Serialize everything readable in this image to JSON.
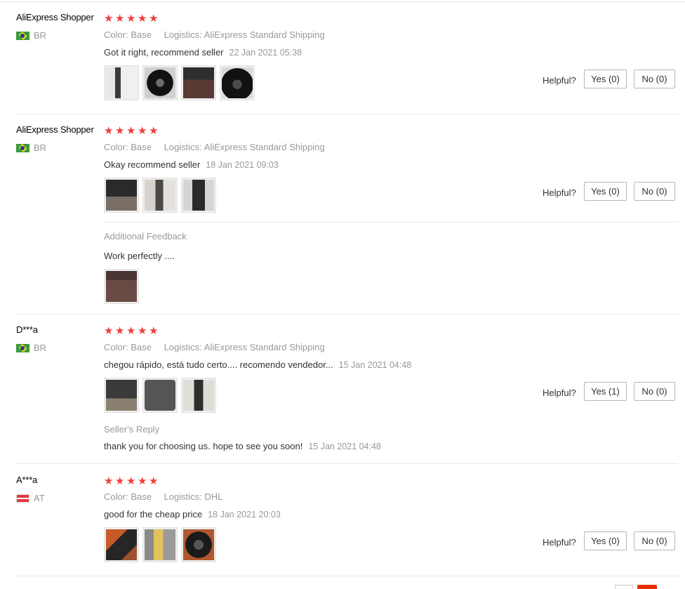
{
  "reviews": [
    {
      "user": "AliExpress Shopper",
      "country": "BR",
      "flag": "brazil-flag",
      "stars": 5,
      "color_label": "Color:",
      "color_value": "Base",
      "logistics_label": "Logistics:",
      "logistics_value": "AliExpress Standard Shipping",
      "text": "Got it right, recommend seller",
      "date": "22 Jan 2021 05:38",
      "photo_count": 4,
      "helpful_label": "Helpful?",
      "yes_label": "Yes (0)",
      "no_label": "No (0)"
    },
    {
      "user": "AliExpress Shopper",
      "country": "BR",
      "flag": "brazil-flag",
      "stars": 5,
      "color_label": "Color:",
      "color_value": "Base",
      "logistics_label": "Logistics:",
      "logistics_value": "AliExpress Standard Shipping",
      "text": "Okay recommend seller",
      "date": "18 Jan 2021 09:03",
      "photo_count": 3,
      "helpful_label": "Helpful?",
      "yes_label": "Yes (0)",
      "no_label": "No (0)",
      "additional_feedback": {
        "heading": "Additional Feedback",
        "text": "Work perfectly ....",
        "photo_count": 1
      }
    },
    {
      "user": "D***a",
      "country": "BR",
      "flag": "brazil-flag",
      "stars": 5,
      "color_label": "Color:",
      "color_value": "Base",
      "logistics_label": "Logistics:",
      "logistics_value": "AliExpress Standard Shipping",
      "text": "chegou rápido, está tudo certo.... recomendo vendedor...",
      "date": "15 Jan 2021 04:48",
      "photo_count": 3,
      "helpful_label": "Helpful?",
      "yes_label": "Yes (1)",
      "no_label": "No (0)",
      "seller_reply": {
        "heading": "Seller's Reply",
        "text": "thank you for choosing us. hope to see you soon!",
        "date": "15 Jan 2021 04:48"
      }
    },
    {
      "user": "A***a",
      "country": "AT",
      "flag": "austria-flag",
      "stars": 5,
      "color_label": "Color:",
      "color_value": "Base",
      "logistics_label": "Logistics:",
      "logistics_value": "DHL",
      "text": "good for the cheap price",
      "date": "18 Jan 2021 20:03",
      "photo_count": 3,
      "helpful_label": "Helpful?",
      "yes_label": "Yes (0)",
      "no_label": "No (0)"
    }
  ],
  "colors": {
    "star": "#f23c3c",
    "muted_text": "#999999",
    "border": "#e8e8e8",
    "pagination_active": "#e62e04"
  }
}
